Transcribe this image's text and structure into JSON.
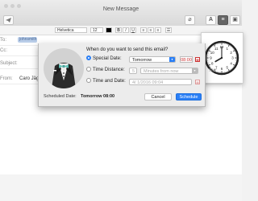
{
  "window": {
    "title": "New Message",
    "toolbar": {
      "attach_icon": "paperclip-icon",
      "font_button": "A",
      "format_icon": "format-icon",
      "photo_icon": "photo-icon"
    }
  },
  "format_bar": {
    "font": "Helvetica",
    "size": "12",
    "bold": "B",
    "italic": "I",
    "underline": "U",
    "color_swatch": "#000000"
  },
  "fields": {
    "to_label": "To:",
    "to_value": "johnsmith",
    "cc_label": "Cc:",
    "subject_label": "Subject:",
    "from_label": "From:",
    "from_value": "Caro Jäg"
  },
  "dialog": {
    "question": "When do you want to send this email?",
    "options": [
      {
        "label": "Special Date:",
        "selected": true,
        "value": "Tomorrow",
        "extra": "08:00"
      },
      {
        "label": "Time Distance:",
        "selected": false,
        "value": "5",
        "unit": "Minutes from now"
      },
      {
        "label": "Time and Date:",
        "selected": false,
        "value": "4/  1/2016 09:04"
      }
    ],
    "scheduled_label": "Scheduled Date:",
    "scheduled_value": "Tomorrow 08:00",
    "cancel_label": "Cancel",
    "schedule_label": "Schedule",
    "icon": "butler-tuxedo-icon"
  },
  "clock": {
    "label": "SNY",
    "hour": 8,
    "minute": 0,
    "numerals": [
      "1",
      "2",
      "3",
      "4",
      "5",
      "6",
      "7",
      "8",
      "9",
      "10",
      "11",
      "12"
    ]
  }
}
